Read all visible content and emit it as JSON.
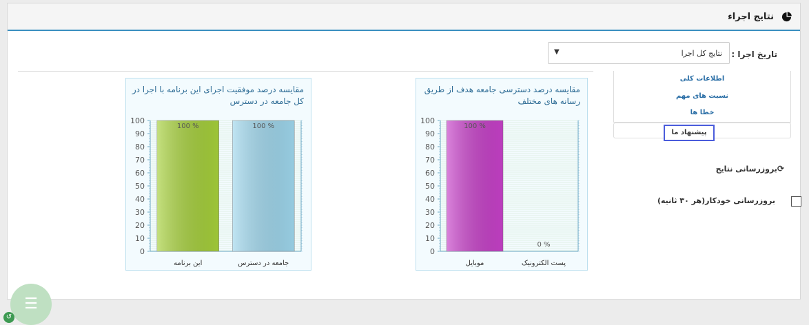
{
  "header": {
    "title": "نتایج اجراء",
    "icon": "pie-chart-icon"
  },
  "filters": {
    "date_label": "تاریخ اجرا :",
    "date_value": "نتایج کل اجرا"
  },
  "nav": {
    "items": [
      {
        "label": "اطلاعات کلی"
      },
      {
        "label": "نسبت های مهم"
      },
      {
        "label": "خطا ها"
      },
      {
        "label": "پیشنهاد ما"
      }
    ]
  },
  "refresh": {
    "title": "بروزرسانی نتایج",
    "auto_label": "بروزرسانی خودکار(هر ۳۰ ثانیه)"
  },
  "chart_data": [
    {
      "type": "bar",
      "title": "مقایسه درصد دسترسی جامعه هدف از طریق رسانه های مختلف",
      "categories": [
        "موبایل",
        "پست الکترونیک"
      ],
      "values": [
        100,
        0
      ],
      "value_labels": [
        "100 %",
        "0 %"
      ],
      "colors": [
        "#c640c8",
        "#f3fbfe"
      ],
      "ylim": [
        0,
        100
      ],
      "yticks": [
        0,
        10,
        20,
        30,
        40,
        50,
        60,
        70,
        80,
        90,
        100
      ],
      "grid": true
    },
    {
      "type": "bar",
      "title": "مقایسه درصد موفقیت اجرای این برنامه با اجرا در کل جامعه در دسترس",
      "categories": [
        "این برنامه",
        "جامعه در دسترس"
      ],
      "values": [
        100,
        100
      ],
      "value_labels": [
        "100 %",
        "100 %"
      ],
      "colors": [
        "#a5cf3a",
        "#9ed6ec"
      ],
      "ylim": [
        0,
        100
      ],
      "yticks": [
        0,
        10,
        20,
        30,
        40,
        50,
        60,
        70,
        80,
        90,
        100
      ],
      "grid": true
    }
  ],
  "fab": {
    "icon": "menu-icon",
    "label": "☰"
  }
}
